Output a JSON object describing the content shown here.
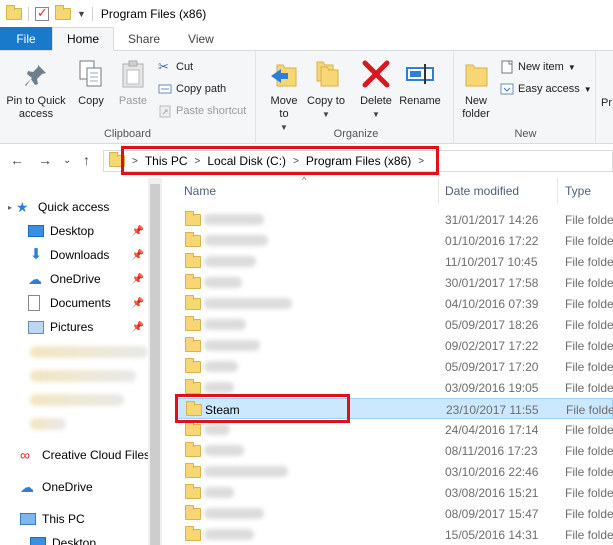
{
  "window": {
    "title": "Program Files (x86)"
  },
  "tabs": [
    "File",
    "Home",
    "Share",
    "View"
  ],
  "ribbon": {
    "clipboard": {
      "label": "Clipboard",
      "pin": "Pin to Quick access",
      "copy": "Copy",
      "paste": "Paste",
      "cut": "Cut",
      "copy_path": "Copy path",
      "paste_shortcut": "Paste shortcut"
    },
    "organize": {
      "label": "Organize",
      "move_to": "Move to",
      "copy_to": "Copy to",
      "delete": "Delete",
      "rename": "Rename"
    },
    "new": {
      "label": "New",
      "new_folder": "New folder",
      "new_item": "New item",
      "easy_access": "Easy access"
    },
    "open_partial": "Pr"
  },
  "address": {
    "crumbs": [
      "This PC",
      "Local Disk (C:)",
      "Program Files (x86)"
    ]
  },
  "navpane": {
    "quick_access": "Quick access",
    "items": [
      {
        "label": "Desktop",
        "icon": "desktop-icon"
      },
      {
        "label": "Downloads",
        "icon": "download-icon"
      },
      {
        "label": "OneDrive",
        "icon": "onedrive-icon"
      },
      {
        "label": "Documents",
        "icon": "documents-icon"
      },
      {
        "label": "Pictures",
        "icon": "pictures-icon"
      }
    ],
    "creative_cloud": "Creative Cloud Files",
    "onedrive": "OneDrive",
    "this_pc": "This PC",
    "desktop_partial": "Desktop"
  },
  "columns": {
    "name": "Name",
    "date": "Date modified",
    "type": "Type"
  },
  "files": [
    {
      "name": "",
      "date": "31/01/2017 14:26",
      "type": "File folder"
    },
    {
      "name": "",
      "date": "01/10/2016 17:22",
      "type": "File folder"
    },
    {
      "name": "",
      "date": "11/10/2017 10:45",
      "type": "File folder"
    },
    {
      "name": "",
      "date": "30/01/2017 17:58",
      "type": "File folder"
    },
    {
      "name": "",
      "date": "04/10/2016 07:39",
      "type": "File folder"
    },
    {
      "name": "",
      "date": "05/09/2017 18:26",
      "type": "File folder"
    },
    {
      "name": "",
      "date": "09/02/2017 17:22",
      "type": "File folder"
    },
    {
      "name": "",
      "date": "05/09/2017 17:20",
      "type": "File folder"
    },
    {
      "name": "",
      "date": "03/09/2016 19:05",
      "type": "File folder"
    },
    {
      "name": "Steam",
      "date": "23/10/2017 11:55",
      "type": "File folder"
    },
    {
      "name": "",
      "date": "24/04/2016 17:14",
      "type": "File folder"
    },
    {
      "name": "",
      "date": "08/11/2016 17:23",
      "type": "File folder"
    },
    {
      "name": "",
      "date": "03/10/2016 22:46",
      "type": "File folder"
    },
    {
      "name": "",
      "date": "03/08/2016 15:21",
      "type": "File folder"
    },
    {
      "name": "",
      "date": "08/09/2017 15:47",
      "type": "File folder"
    },
    {
      "name": "",
      "date": "15/05/2016 14:31",
      "type": "File folder"
    }
  ],
  "colors": {
    "highlight": "#e0101b",
    "selection": "#cce8ff",
    "file_tab": "#1979ca"
  }
}
